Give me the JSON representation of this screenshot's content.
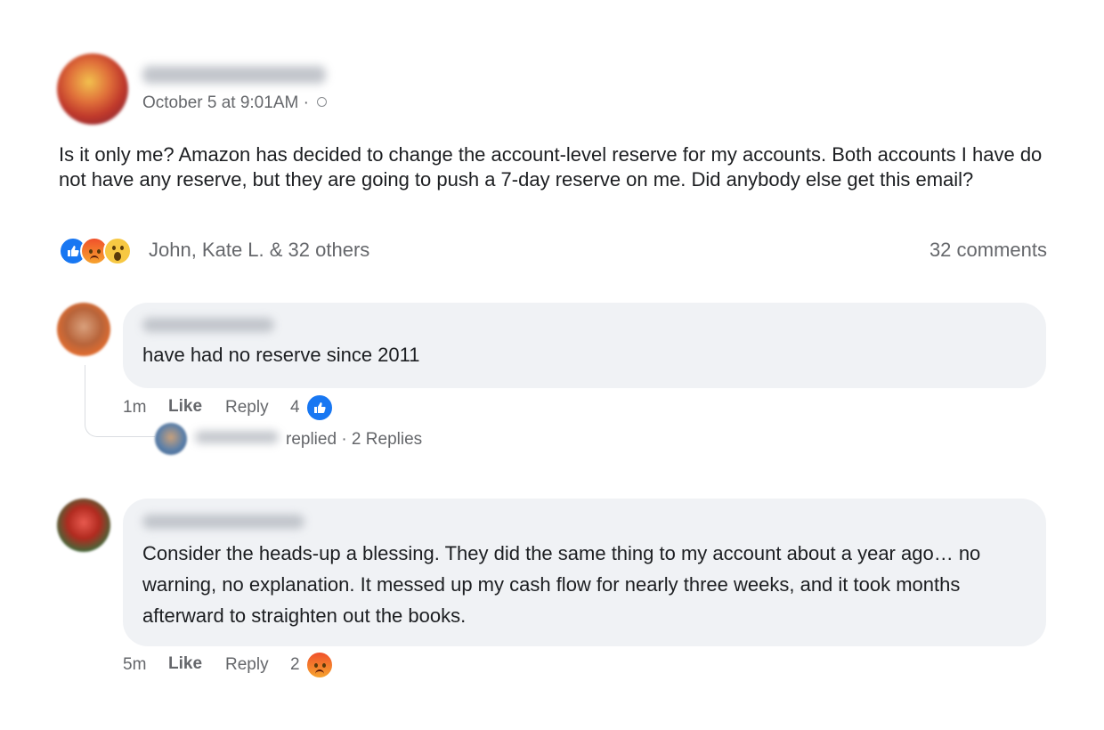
{
  "post": {
    "timestamp": "October 5 at 9:01AM",
    "separator": "·",
    "text": "Is it only me? Amazon has decided to change the account-level reserve for my accounts. Both accounts I have do not have any reserve, but they are going to push a 7-day reserve on me. Did anybody else get this email?",
    "reactions": {
      "icons": [
        "like-icon",
        "angry-icon",
        "wow-icon"
      ],
      "summary": "John, Kate L. & 32 others"
    },
    "comment_count": "32 comments"
  },
  "comments": [
    {
      "text": "have had no reserve since 2011",
      "time": "1m",
      "like_label": "Like",
      "reply_label": "Reply",
      "reaction_count": "4",
      "reaction_icon": "like-icon",
      "replies": {
        "replied_label": "replied",
        "replies_label": "· 2 Replies"
      }
    },
    {
      "text": "Consider the heads-up a blessing. They did the same thing to my account about a year ago… no warning, no explanation. It messed up my cash flow for nearly three weeks, and it took months afterward to straighten out the books.",
      "time": "5m",
      "like_label": "Like",
      "reply_label": "Reply",
      "reaction_count": "2",
      "reaction_icon": "angry-icon"
    }
  ],
  "colors": {
    "like_blue": "#1877f2",
    "bubble_bg": "#f0f2f5",
    "meta_gray": "#65676b",
    "text": "#1c1e21"
  }
}
